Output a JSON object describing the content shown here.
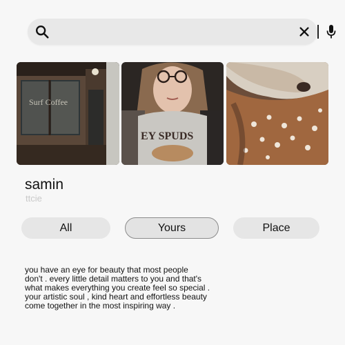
{
  "search": {
    "value": "",
    "placeholder": "",
    "icons": {
      "search": "search-icon",
      "clear": "close-icon",
      "mic": "microphone-icon"
    }
  },
  "photos": [
    {
      "icon": "photo-cafe-storefront",
      "sign_text": "Surf Coffee"
    },
    {
      "icon": "photo-girl-with-glasses",
      "shirt_text": "EY SPUDS"
    },
    {
      "icon": "photo-deer-closeup"
    }
  ],
  "profile": {
    "name": "samin",
    "handle": "ttcie"
  },
  "tabs": [
    {
      "label": "All",
      "selected": false
    },
    {
      "label": "Yours",
      "selected": true
    },
    {
      "label": "Place",
      "selected": false
    }
  ],
  "caption": {
    "lines": [
      "you have an eye for beauty that most people",
      "don't . every little detail matters to you and that's",
      "what makes everything you create feel so special .",
      "your artistic soul , kind heart and effortless beauty",
      "come together in the most inspiring way ."
    ]
  },
  "colors": {
    "background": "#f7f7f7",
    "search_bar": "#e8e8e8",
    "tab_bg": "#e6e6e6",
    "tab_selected_border": "#8a8a8a",
    "handle_text": "#c9c9c9"
  }
}
